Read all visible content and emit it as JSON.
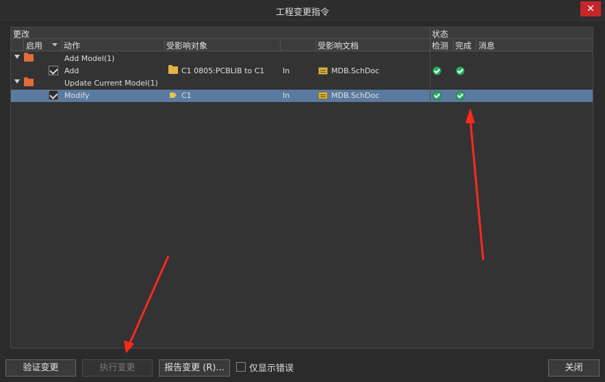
{
  "window": {
    "title": "工程变更指令",
    "close_glyph": "✕"
  },
  "grid": {
    "group_headers": {
      "change": "更改",
      "status": "状态"
    },
    "columns": {
      "enable": "启用",
      "action": "动作",
      "affected_object": "受影响对象",
      "affected_document": "受影响文档",
      "check": "检测",
      "done": "完成",
      "message": "消息"
    },
    "rows": [
      {
        "type": "group",
        "label": "Add Model(1)"
      },
      {
        "type": "item",
        "action": "Add",
        "object": "C1 0805:PCBLIB to C1",
        "direction": "In",
        "document": "MDB.SchDoc",
        "check": "ok",
        "done": "ok"
      },
      {
        "type": "group",
        "label": "Update Current Model(1)"
      },
      {
        "type": "item",
        "action": "Modify",
        "object": "C1",
        "direction": "In",
        "document": "MDB.SchDoc",
        "check": "ok",
        "done": "ok",
        "selected": true
      }
    ]
  },
  "footer": {
    "validate_button": "验证变更",
    "execute_button": "执行变更",
    "report_button": "报告变更 (R)...",
    "errors_only_label": "仅显示错误",
    "close_button": "关闭"
  },
  "colors": {
    "selection": "#5b7aa0",
    "annotation_arrow": "#ff2a1a",
    "ok": "#2fae62"
  }
}
